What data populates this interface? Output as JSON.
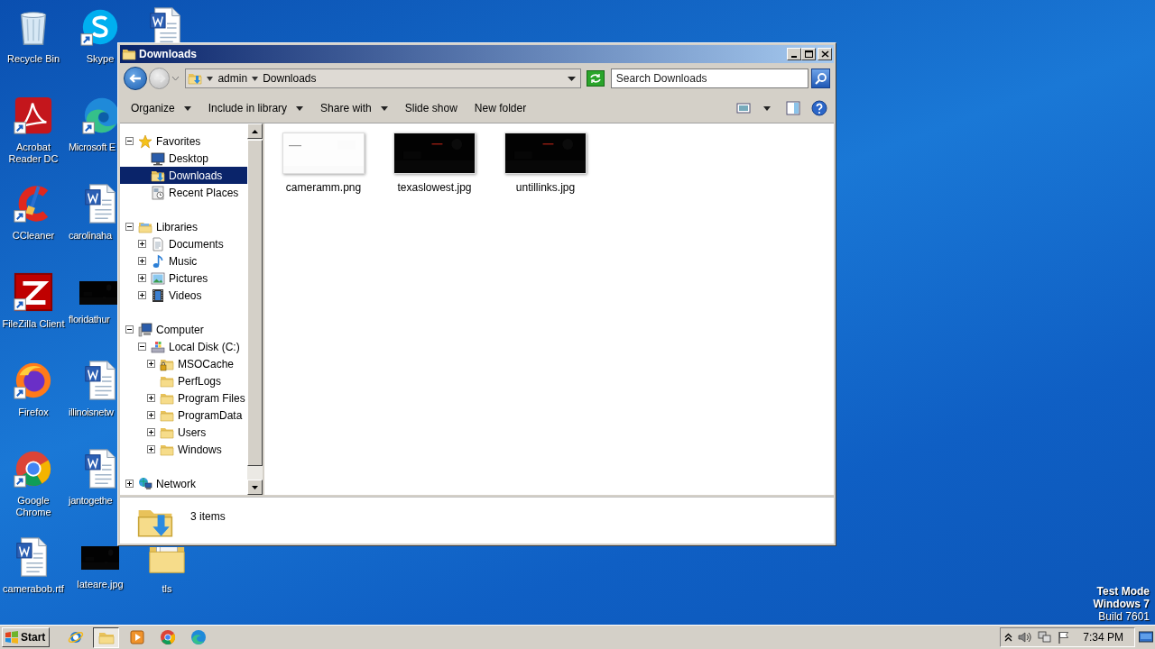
{
  "desktop_icons": [
    {
      "kind": "recycle_bin",
      "label": "Recycle Bin",
      "shortcut": false
    },
    {
      "kind": "acrobat",
      "label": "Acrobat Reader DC",
      "shortcut": true
    },
    {
      "kind": "ccleaner",
      "label": "CCleaner",
      "shortcut": true
    },
    {
      "kind": "filezilla",
      "label": "FileZilla Client",
      "shortcut": true
    },
    {
      "kind": "firefox",
      "label": "Firefox",
      "shortcut": true
    },
    {
      "kind": "chrome",
      "label": "Google Chrome",
      "shortcut": true
    },
    {
      "kind": "word",
      "label": "camerabob.rtf",
      "shortcut": false
    },
    {
      "kind": "skype",
      "label": "Skype",
      "shortcut": true
    },
    {
      "kind": "edge",
      "label": "Microsoft E",
      "shortcut": true
    },
    {
      "kind": "word",
      "label": "carolinaha",
      "shortcut": false
    },
    {
      "kind": "dark_image",
      "label": "floridathur"
    },
    {
      "kind": "word",
      "label": "illinoisnetw",
      "shortcut": false
    },
    {
      "kind": "word",
      "label": "jantogethe",
      "shortcut": false
    },
    {
      "kind": "dark_image",
      "label": "lateare.jpg"
    },
    {
      "kind": "word",
      "shortcut": false
    },
    {
      "kind": "folder",
      "label": "tls",
      "shortcut": false
    }
  ],
  "window": {
    "title": "Downloads",
    "back": {
      "disabled": false
    },
    "forward": {
      "disabled": true
    },
    "breadcrumbs": [
      "admin",
      "Downloads"
    ],
    "search": {
      "placeholder": "Search Downloads"
    },
    "toolbar": [
      {
        "label": "Organize",
        "menu": true
      },
      {
        "label": "Include in library",
        "menu": true
      },
      {
        "label": "Share with",
        "menu": true
      },
      {
        "label": "Slide show",
        "menu": false
      },
      {
        "label": "New folder",
        "menu": false
      }
    ],
    "nav_tree": [
      {
        "kind": "favorites",
        "label": "Favorites",
        "expanded": true,
        "selected": false,
        "children": [
          {
            "kind": "desktop",
            "label": "Desktop",
            "selected": false
          },
          {
            "kind": "downloads",
            "label": "Downloads",
            "selected": true
          },
          {
            "kind": "recent",
            "label": "Recent Places",
            "selected": false
          }
        ]
      },
      {
        "kind": "libraries",
        "label": "Libraries",
        "expanded": true,
        "selected": false,
        "children": [
          {
            "kind": "documents",
            "label": "Documents",
            "expanded": false,
            "selected": false
          },
          {
            "kind": "music",
            "label": "Music",
            "expanded": false,
            "selected": false
          },
          {
            "kind": "pictures",
            "label": "Pictures",
            "expanded": false,
            "selected": false
          },
          {
            "kind": "videos",
            "label": "Videos",
            "expanded": false,
            "selected": false
          }
        ]
      },
      {
        "kind": "computer",
        "label": "Computer",
        "expanded": true,
        "selected": false,
        "children": [
          {
            "kind": "disk",
            "label": "Local Disk (C:)",
            "expanded": true,
            "selected": false,
            "children": [
              {
                "kind": "locked_folder",
                "label": "MSOCache",
                "expanded": false,
                "selected": false
              },
              {
                "kind": "folder",
                "label": "PerfLogs",
                "selected": false
              },
              {
                "kind": "folder",
                "label": "Program Files",
                "expanded": false,
                "selected": false
              },
              {
                "kind": "folder",
                "label": "ProgramData",
                "expanded": false,
                "selected": false
              },
              {
                "kind": "folder",
                "label": "Users",
                "expanded": false,
                "selected": false
              },
              {
                "kind": "folder",
                "label": "Windows",
                "expanded": false,
                "selected": false
              }
            ]
          }
        ]
      },
      {
        "kind": "network",
        "label": "Network",
        "expanded": false,
        "selected": false
      }
    ],
    "files": [
      {
        "name": "cameramm.png",
        "kind": "light"
      },
      {
        "name": "texaslowest.jpg",
        "kind": "dark"
      },
      {
        "name": "untillinks.jpg",
        "kind": "dark"
      }
    ],
    "status": "3 items"
  },
  "taskbar": {
    "start": "Start",
    "apps": [
      {
        "kind": "ie",
        "selected": false
      },
      {
        "kind": "explorer",
        "selected": true
      },
      {
        "kind": "media",
        "selected": false
      },
      {
        "kind": "chrome",
        "selected": false
      },
      {
        "kind": "edge",
        "selected": false
      }
    ],
    "time": "7:34 PM"
  },
  "os_notice": [
    {
      "text": "Test Mode",
      "bold": true
    },
    {
      "text": "Windows 7",
      "bold": true
    },
    {
      "text": "Build 7601",
      "bold": false
    }
  ]
}
